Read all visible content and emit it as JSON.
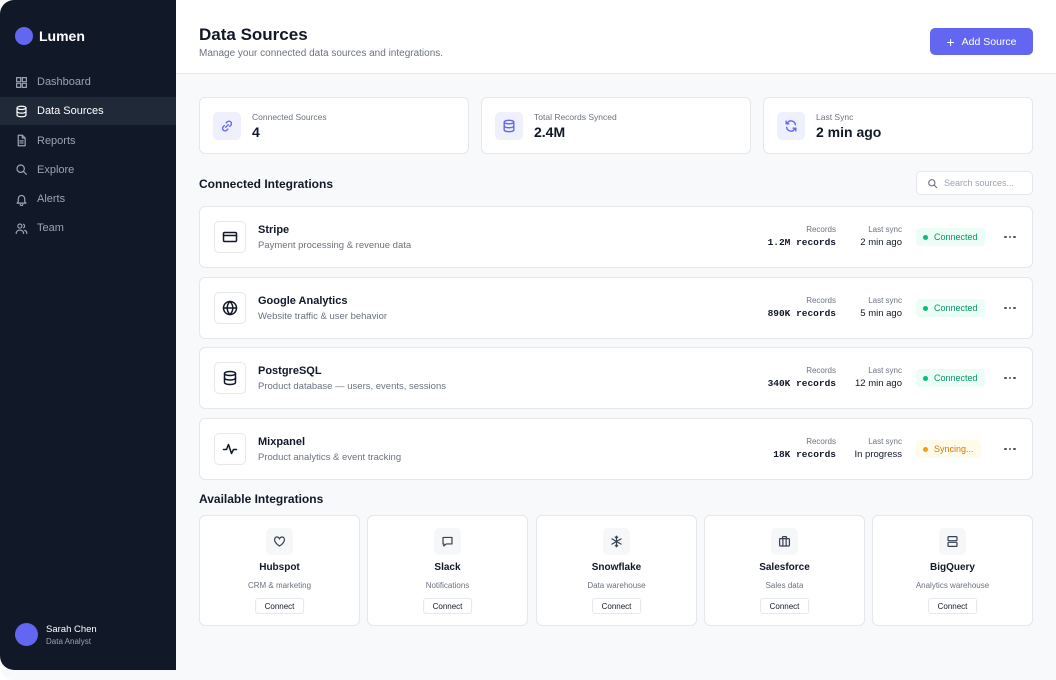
{
  "app": {
    "name": "Lumen"
  },
  "sidebar": {
    "items": [
      {
        "label": "Dashboard",
        "icon": "grid-icon"
      },
      {
        "label": "Data Sources",
        "icon": "database-icon",
        "active": true
      },
      {
        "label": "Reports",
        "icon": "file-icon"
      },
      {
        "label": "Explore",
        "icon": "search-icon"
      },
      {
        "label": "Alerts",
        "icon": "bell-icon"
      },
      {
        "label": "Team",
        "icon": "users-icon"
      }
    ],
    "user": {
      "name": "Sarah Chen",
      "role": "Data Analyst"
    }
  },
  "header": {
    "title": "Data Sources",
    "subtitle": "Manage your connected data sources and integrations.",
    "add_button_label": "Add Source"
  },
  "stats": [
    {
      "label": "Connected Sources",
      "value": "4",
      "icon": "link-icon"
    },
    {
      "label": "Total Records Synced",
      "value": "2.4M",
      "icon": "database-icon"
    },
    {
      "label": "Last Sync",
      "value": "2 min ago",
      "icon": "refresh-icon"
    }
  ],
  "connected": {
    "title": "Connected Integrations",
    "search_placeholder": "Search sources...",
    "records_label": "Records",
    "last_sync_label": "Last sync",
    "items": [
      {
        "name": "Stripe",
        "description": "Payment processing & revenue data",
        "records": "1.2M records",
        "last_sync": "2 min ago",
        "status": "Connected",
        "icon": "credit-card-icon"
      },
      {
        "name": "Google Analytics",
        "description": "Website traffic & user behavior",
        "records": "890K records",
        "last_sync": "5 min ago",
        "status": "Connected",
        "icon": "globe-icon"
      },
      {
        "name": "PostgreSQL",
        "description": "Product database — users, events, sessions",
        "records": "340K records",
        "last_sync": "12 min ago",
        "status": "Connected",
        "icon": "database-icon"
      },
      {
        "name": "Mixpanel",
        "description": "Product analytics & event tracking",
        "records": "18K records",
        "last_sync": "In progress",
        "status": "Syncing...",
        "icon": "activity-icon"
      }
    ]
  },
  "available": {
    "title": "Available Integrations",
    "connect_label": "Connect",
    "items": [
      {
        "name": "Hubspot",
        "description": "CRM & marketing",
        "icon": "heart-icon"
      },
      {
        "name": "Slack",
        "description": "Notifications",
        "icon": "message-icon"
      },
      {
        "name": "Snowflake",
        "description": "Data warehouse",
        "icon": "snowflake-icon"
      },
      {
        "name": "Salesforce",
        "description": "Sales data",
        "icon": "briefcase-icon"
      },
      {
        "name": "BigQuery",
        "description": "Analytics warehouse",
        "icon": "server-icon"
      }
    ]
  },
  "colors": {
    "accent": "#6366f1",
    "sidebar_bg": "#111827",
    "connected": "#059669",
    "syncing": "#d97706"
  }
}
